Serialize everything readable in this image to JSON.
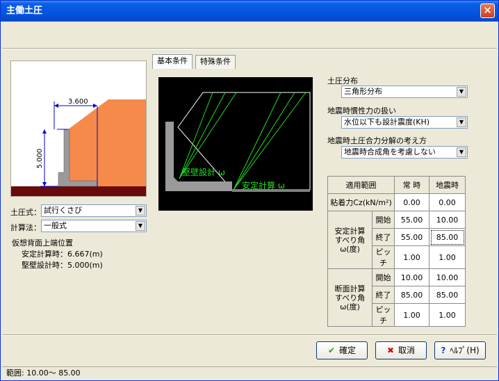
{
  "window": {
    "title": "主働土圧",
    "close_glyph": "✕"
  },
  "left": {
    "figure": {
      "dim_width": "3.600",
      "dim_height": "5.000"
    },
    "earth_formula": {
      "label": "土圧式：",
      "value": "試行くさび"
    },
    "calc_method": {
      "label": "計算法：",
      "value": "一般式"
    },
    "virtual_back_title": "仮想背面上端位置",
    "stability_line": "安定計算時：6.667(m)",
    "wall_line": "堅壁設計時：5.000(m)"
  },
  "tabs": [
    {
      "label": "基本条件",
      "active": true
    },
    {
      "label": "特殊条件",
      "active": false
    }
  ],
  "canvas": {
    "wall_label": "堅壁設計 ω",
    "stability_label": "安定計算 ω"
  },
  "right": {
    "earth_dist": {
      "label": "土圧分布",
      "value": "三角形分布"
    },
    "seismic_inertia": {
      "label": "地震時慣性力の扱い",
      "value": "水位以下も設計震度(KH)"
    },
    "seismic_resultant": {
      "label": "地震時土圧合力分解の考え方",
      "value": "地震時合成角を考慮しない"
    }
  },
  "table": {
    "header": {
      "range": "適用範囲",
      "normal": "常 時",
      "seismic": "地震時"
    },
    "cohesion": {
      "label": "粘着力Cz(kN/m²)",
      "normal": "0.00",
      "seismic": "0.00"
    },
    "stability_group": "安定計算\nすべり角\nω(度)",
    "section_group": "断面計算\nすべり角\nω(度)",
    "stability_rows": [
      {
        "label": "開始",
        "normal": "55.00",
        "seismic": "10.00"
      },
      {
        "label": "終了",
        "normal": "55.00",
        "seismic": "85.00"
      },
      {
        "label": "ピッチ",
        "normal": "1.00",
        "seismic": "1.00"
      }
    ],
    "section_rows": [
      {
        "label": "開始",
        "normal": "10.00",
        "seismic": "10.00"
      },
      {
        "label": "終了",
        "normal": "85.00",
        "seismic": "85.00"
      },
      {
        "label": "ピッチ",
        "normal": "1.00",
        "seismic": "1.00"
      }
    ]
  },
  "buttons": {
    "ok": {
      "icon": "✔",
      "label": "確定"
    },
    "cancel": {
      "icon": "✖",
      "label": "取消"
    },
    "help": {
      "icon": "?",
      "label": "ﾍﾙﾌﾟ(H)"
    }
  },
  "status": "範囲:  10.00～  85.00",
  "colors": {
    "soil": "#f58a4b",
    "ground": "#6a0a0a",
    "wall": "#9a9a9a",
    "slip_lines": "#22dd22"
  }
}
